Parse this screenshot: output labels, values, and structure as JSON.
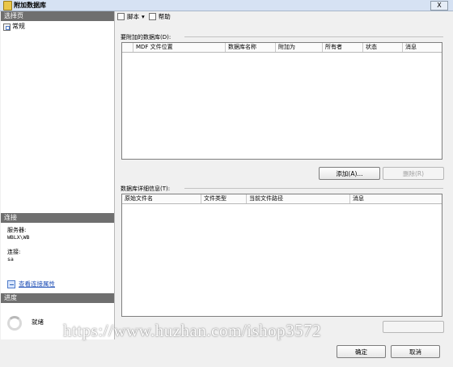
{
  "window": {
    "title": "附加数据库",
    "close_label": "X"
  },
  "left_pane": {
    "select_page_header": "选择页",
    "nav_items": [
      {
        "label": "常规",
        "icon": "general-page-icon"
      }
    ],
    "connection_header": "连接",
    "server_label": "服务器:",
    "server_value": "WBLX\\WB",
    "connection_label": "连接:",
    "connection_value": "sa",
    "view_properties_link": "查看连接属性",
    "progress_header": "进度",
    "progress_status": "就绪"
  },
  "toolbar": {
    "script_label": "脚本",
    "help_label": "帮助"
  },
  "attach_section": {
    "label": "要附加的数据库(D):",
    "columns": [
      "",
      "MDF 文件位置",
      "数据库名称",
      "附加为",
      "所有者",
      "状态",
      "消息"
    ],
    "add_button": "添加(A)...",
    "remove_button": "删除(R)"
  },
  "details_section": {
    "label": "数据库详细信息(T):",
    "columns": [
      "原始文件名",
      "文件类型",
      "当前文件路径",
      "消息"
    ]
  },
  "dialog_buttons": {
    "ok": "确定",
    "cancel": "取消"
  },
  "watermark": "https://www.huzhan.com/ishop3572"
}
